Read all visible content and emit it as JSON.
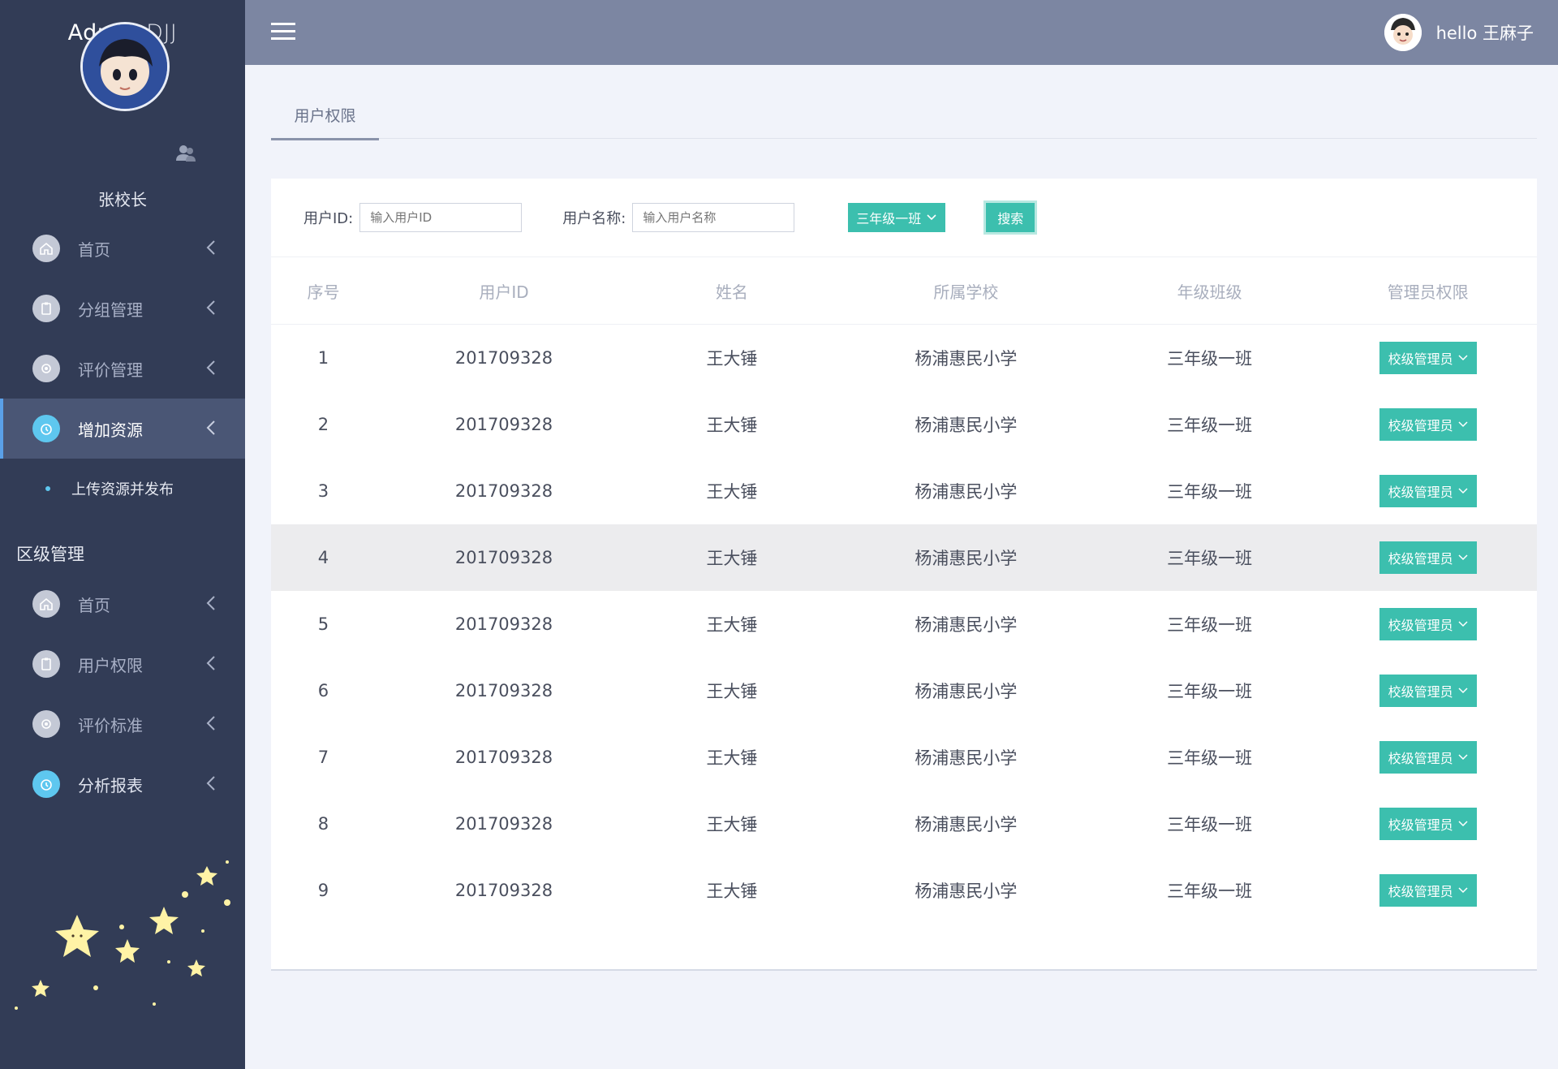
{
  "sidebar": {
    "brand": {
      "main": "Admin",
      "sub": "DJJ"
    },
    "school_name": "张校长",
    "menu": [
      {
        "label": "首页",
        "icon": "home-icon",
        "active": false
      },
      {
        "label": "分组管理",
        "icon": "clipboard-icon",
        "active": false
      },
      {
        "label": "评价管理",
        "icon": "gear-icon",
        "active": false
      },
      {
        "label": "增加资源",
        "icon": "alarm-clock-icon",
        "active": true
      }
    ],
    "sub_item": "上传资源并发布",
    "section_title": "区级管理",
    "menu2": [
      {
        "label": "首页",
        "icon": "home-icon",
        "active": false
      },
      {
        "label": "用户权限",
        "icon": "clipboard-icon",
        "active": false
      },
      {
        "label": "评价标准",
        "icon": "gear-icon",
        "active": false
      },
      {
        "label": "分析报表",
        "icon": "alarm-clock-icon",
        "active": false
      }
    ]
  },
  "header": {
    "greeting": "hello 王麻子"
  },
  "tab": {
    "label": "用户权限"
  },
  "filter": {
    "user_id_label": "用户ID:",
    "user_id_placeholder": "输入用户ID",
    "user_name_label": "用户名称:",
    "user_name_placeholder": "输入用户名称",
    "class_select": "三年级一班",
    "search_button": "搜索"
  },
  "table": {
    "headers": [
      "序号",
      "用户ID",
      "姓名",
      "所属学校",
      "年级班级",
      "管理员权限"
    ],
    "rows": [
      [
        "1",
        "201709328",
        "王大锤",
        "杨浦惠民小学",
        "三年级一班",
        "校级管理员"
      ],
      [
        "2",
        "201709328",
        "王大锤",
        "杨浦惠民小学",
        "三年级一班",
        "校级管理员"
      ],
      [
        "3",
        "201709328",
        "王大锤",
        "杨浦惠民小学",
        "三年级一班",
        "校级管理员"
      ],
      [
        "4",
        "201709328",
        "王大锤",
        "杨浦惠民小学",
        "三年级一班",
        "校级管理员"
      ],
      [
        "5",
        "201709328",
        "王大锤",
        "杨浦惠民小学",
        "三年级一班",
        "校级管理员"
      ],
      [
        "6",
        "201709328",
        "王大锤",
        "杨浦惠民小学",
        "三年级一班",
        "校级管理员"
      ],
      [
        "7",
        "201709328",
        "王大锤",
        "杨浦惠民小学",
        "三年级一班",
        "校级管理员"
      ],
      [
        "8",
        "201709328",
        "王大锤",
        "杨浦惠民小学",
        "三年级一班",
        "校级管理员"
      ],
      [
        "9",
        "201709328",
        "王大锤",
        "杨浦惠民小学",
        "三年级一班",
        "校级管理员"
      ]
    ],
    "highlighted_row": 4
  },
  "colors": {
    "sidebar": "#323c56",
    "header": "#7c86a2",
    "accent": "#3cbfae",
    "active_icon": "#5ec7ef"
  }
}
